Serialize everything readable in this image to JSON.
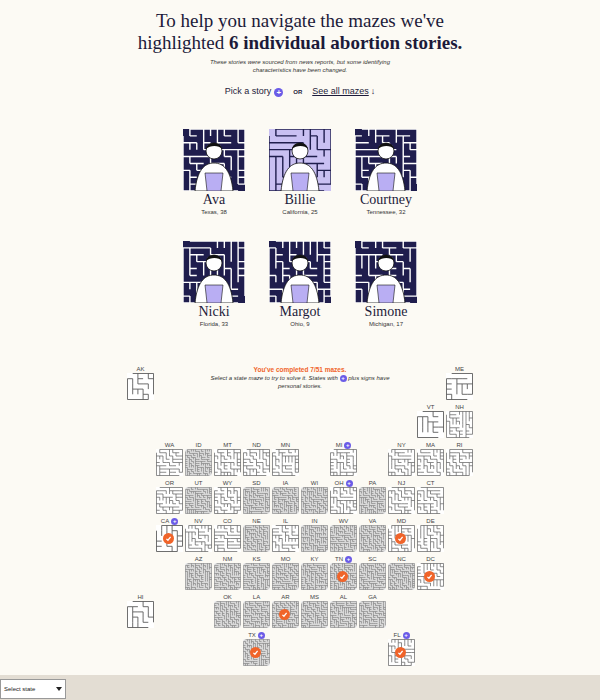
{
  "heading": {
    "line1": "To help you navigate the mazes we've",
    "line2_prefix": "highlighted ",
    "line2_bold": "6 individual abortion stories."
  },
  "subtitle": {
    "line1": "These stories were sourced from news reports, but some identifying",
    "line2": "characteristics have been changed."
  },
  "nav": {
    "pick": "Pick a story",
    "pick_icon": "+",
    "or": "OR",
    "see_all": "See all mazes",
    "arrow": "↓"
  },
  "stories": [
    {
      "name": "Ava",
      "place": "Texas, 38",
      "kind": "dark"
    },
    {
      "name": "Billie",
      "place": "California, 25",
      "kind": "light"
    },
    {
      "name": "Courtney",
      "place": "Tennessee, 32",
      "kind": "dark"
    },
    {
      "name": "Nicki",
      "place": "Florida, 33",
      "kind": "dark"
    },
    {
      "name": "Margot",
      "place": "Ohio, 9",
      "kind": "dark"
    },
    {
      "name": "Simone",
      "place": "Michigan, 17",
      "kind": "dark"
    }
  ],
  "map": {
    "status": "You've completed 7/51 mazes.",
    "instructions_before": "Select a state maze to try to solve it. States with",
    "story_icon": "+",
    "instructions_after": "plus signs have personal stories."
  },
  "states": [
    {
      "code": "AK",
      "kind": "simple",
      "story": false,
      "completed": false
    },
    {
      "code": "ME",
      "kind": "simple",
      "story": false,
      "completed": false
    },
    {
      "code": "VT",
      "kind": "simple",
      "story": false,
      "completed": false
    },
    {
      "code": "NH",
      "kind": "medium",
      "story": false,
      "completed": false
    },
    {
      "code": "WA",
      "kind": "medium",
      "story": false,
      "completed": false
    },
    {
      "code": "ID",
      "kind": "dense",
      "story": false,
      "completed": false
    },
    {
      "code": "MT",
      "kind": "medium",
      "story": false,
      "completed": false
    },
    {
      "code": "ND",
      "kind": "medium",
      "story": false,
      "completed": false
    },
    {
      "code": "MN",
      "kind": "medium",
      "story": false,
      "completed": false
    },
    {
      "code": "MI",
      "kind": "medium",
      "story": true,
      "completed": false
    },
    {
      "code": "NY",
      "kind": "medium",
      "story": false,
      "completed": false
    },
    {
      "code": "MA",
      "kind": "medium",
      "story": false,
      "completed": false
    },
    {
      "code": "RI",
      "kind": "medium",
      "story": false,
      "completed": false
    },
    {
      "code": "OR",
      "kind": "medium",
      "story": false,
      "completed": false
    },
    {
      "code": "UT",
      "kind": "dense",
      "story": false,
      "completed": false
    },
    {
      "code": "WY",
      "kind": "medium",
      "story": false,
      "completed": false
    },
    {
      "code": "SD",
      "kind": "dense",
      "story": false,
      "completed": false
    },
    {
      "code": "IA",
      "kind": "dense",
      "story": false,
      "completed": false
    },
    {
      "code": "WI",
      "kind": "dense",
      "story": false,
      "completed": false
    },
    {
      "code": "OH",
      "kind": "medium",
      "story": true,
      "completed": false
    },
    {
      "code": "PA",
      "kind": "dense",
      "story": false,
      "completed": false
    },
    {
      "code": "NJ",
      "kind": "medium",
      "story": false,
      "completed": false
    },
    {
      "code": "CT",
      "kind": "medium",
      "story": false,
      "completed": false
    },
    {
      "code": "CA",
      "kind": "simple",
      "story": true,
      "completed": true
    },
    {
      "code": "NV",
      "kind": "medium",
      "story": false,
      "completed": false
    },
    {
      "code": "CO",
      "kind": "medium",
      "story": false,
      "completed": false
    },
    {
      "code": "NE",
      "kind": "dense",
      "story": false,
      "completed": false
    },
    {
      "code": "IL",
      "kind": "medium",
      "story": false,
      "completed": false
    },
    {
      "code": "IN",
      "kind": "dense",
      "story": false,
      "completed": false
    },
    {
      "code": "WV",
      "kind": "dense",
      "story": false,
      "completed": false
    },
    {
      "code": "VA",
      "kind": "dense",
      "story": false,
      "completed": false
    },
    {
      "code": "MD",
      "kind": "medium",
      "story": false,
      "completed": true
    },
    {
      "code": "DE",
      "kind": "medium",
      "story": false,
      "completed": false
    },
    {
      "code": "AZ",
      "kind": "dense",
      "story": false,
      "completed": false
    },
    {
      "code": "NM",
      "kind": "dense",
      "story": false,
      "completed": false
    },
    {
      "code": "KS",
      "kind": "dense",
      "story": false,
      "completed": false
    },
    {
      "code": "MO",
      "kind": "dense",
      "story": false,
      "completed": false
    },
    {
      "code": "KY",
      "kind": "dense",
      "story": false,
      "completed": false
    },
    {
      "code": "TN",
      "kind": "dense",
      "story": true,
      "completed": true
    },
    {
      "code": "SC",
      "kind": "dense",
      "story": false,
      "completed": false
    },
    {
      "code": "NC",
      "kind": "dense",
      "story": false,
      "completed": false
    },
    {
      "code": "DC",
      "kind": "medium",
      "story": false,
      "completed": true
    },
    {
      "code": "HI",
      "kind": "simple",
      "story": false,
      "completed": false
    },
    {
      "code": "OK",
      "kind": "dense",
      "story": false,
      "completed": false
    },
    {
      "code": "LA",
      "kind": "dense",
      "story": false,
      "completed": false
    },
    {
      "code": "AR",
      "kind": "dense",
      "story": false,
      "completed": true
    },
    {
      "code": "MS",
      "kind": "dense",
      "story": false,
      "completed": false
    },
    {
      "code": "AL",
      "kind": "dense",
      "story": false,
      "completed": false
    },
    {
      "code": "GA",
      "kind": "dense",
      "story": false,
      "completed": false
    },
    {
      "code": "TX",
      "kind": "dense",
      "story": true,
      "completed": true
    },
    {
      "code": "FL",
      "kind": "medium",
      "story": true,
      "completed": true
    }
  ],
  "select": {
    "placeholder": "Select state"
  }
}
